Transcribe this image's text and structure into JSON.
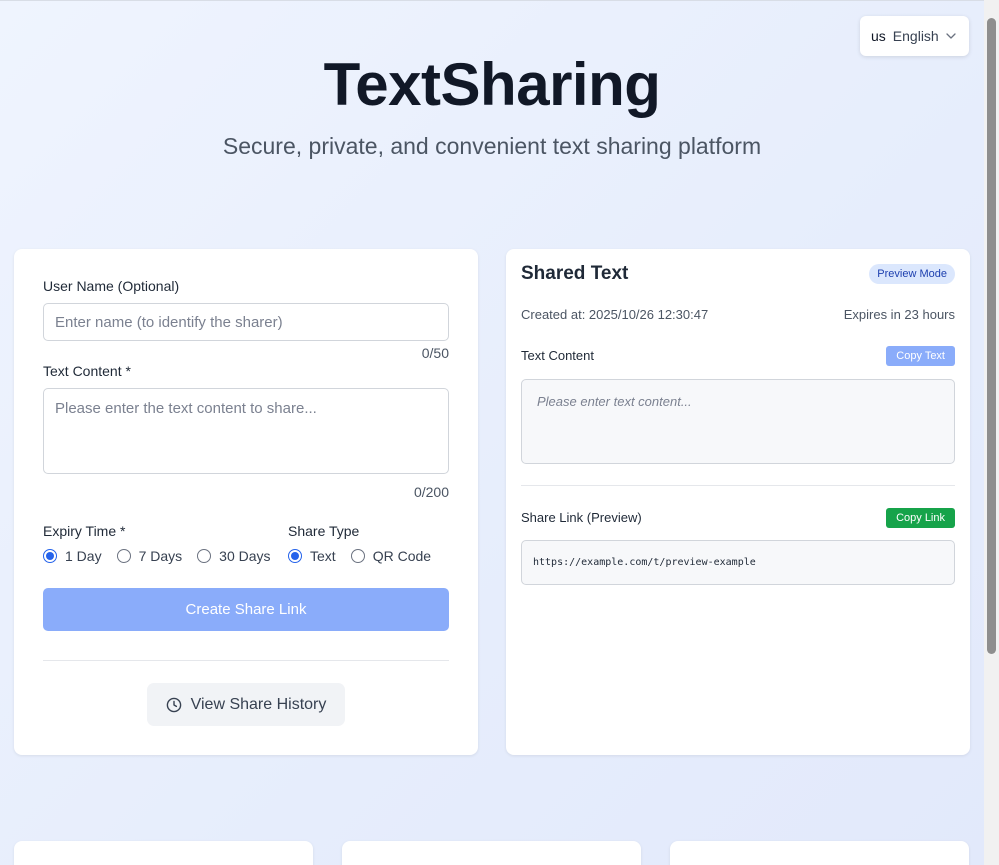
{
  "language": {
    "flag": "us",
    "label": "English"
  },
  "hero": {
    "title": "TextSharing",
    "subtitle": "Secure, private, and convenient text sharing platform"
  },
  "form": {
    "username_label": "User Name (Optional)",
    "username_placeholder": "Enter name (to identify the sharer)",
    "username_value": "",
    "username_counter": "0/50",
    "content_label": "Text Content *",
    "content_placeholder": "Please enter the text content to share...",
    "content_value": "",
    "content_counter": "0/200",
    "expiry_label": "Expiry Time *",
    "expiry_options": [
      {
        "label": "1 Day",
        "checked": true
      },
      {
        "label": "7 Days",
        "checked": false
      },
      {
        "label": "30 Days",
        "checked": false
      }
    ],
    "share_type_label": "Share Type",
    "share_type_options": [
      {
        "label": "Text",
        "checked": true
      },
      {
        "label": "QR Code",
        "checked": false
      }
    ],
    "create_button": "Create Share Link",
    "history_button": "View Share History"
  },
  "preview": {
    "title": "Shared Text",
    "badge": "Preview Mode",
    "created_at": "Created at: 2025/10/26 12:30:47",
    "expires": "Expires in 23 hours",
    "content_label": "Text Content",
    "copy_text_button": "Copy Text",
    "content_placeholder": "Please enter text content...",
    "link_label": "Share Link (Preview)",
    "copy_link_button": "Copy Link",
    "link_value": "https://example.com/t/preview-example"
  },
  "colors": {
    "accent": "#2563eb",
    "create_button": "#8aacfa",
    "copy_text_button": "#8aacfa",
    "copy_link_button": "#16a34a",
    "badge_bg": "#dbe7fd",
    "badge_text": "#1e40af"
  }
}
